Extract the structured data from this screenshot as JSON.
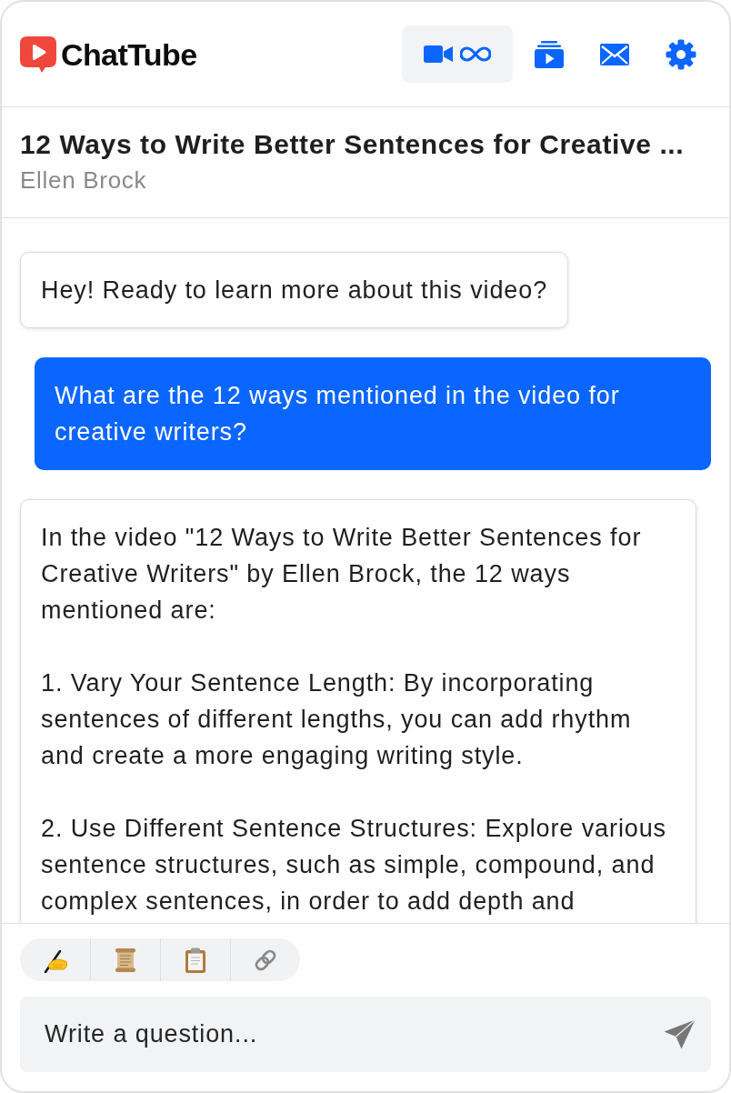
{
  "header": {
    "app_name": "ChatTube",
    "nav": [
      {
        "selected": true
      },
      {
        "selected": false
      },
      {
        "selected": false
      },
      {
        "selected": false
      }
    ]
  },
  "video": {
    "title": "12 Ways to Write Better Sentences for Creative ...",
    "author": "Ellen Brock"
  },
  "messages": [
    {
      "kind": "bot",
      "paragraphs": [
        "Hey! Ready to learn more about this video?"
      ]
    },
    {
      "kind": "user",
      "paragraphs": [
        "What are the 12 ways mentioned in the video for creative writers?"
      ]
    },
    {
      "kind": "bot",
      "paragraphs": [
        "In the video \"12 Ways to Write Better Sentences for Creative Writers\" by Ellen Brock, the 12 ways mentioned are:",
        "1. Vary Your Sentence Length: By incorporating sentences of different lengths, you can add rhythm and create a more engaging writing style.",
        "2. Use Different Sentence Structures: Explore various sentence structures, such as simple, compound, and complex sentences, in order to add depth and"
      ]
    }
  ],
  "composer": {
    "placeholder": "Write a question..."
  }
}
